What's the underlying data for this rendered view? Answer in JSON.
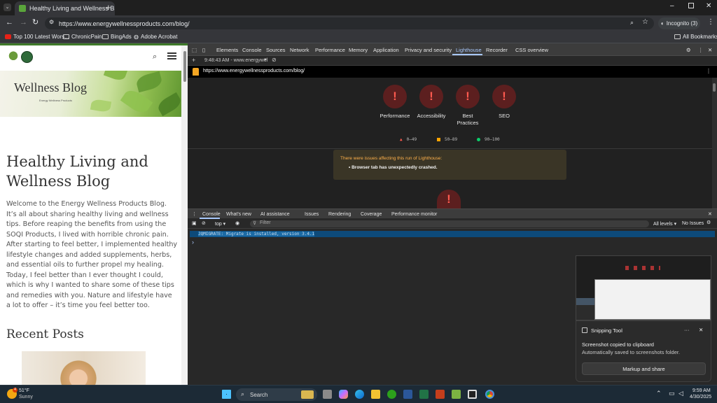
{
  "browser": {
    "tab_title": "Healthy Living and Wellness Blo",
    "url": "https://www.energywellnessproducts.com/blog/",
    "incognito_label": "Incognito (3)",
    "bookmarks": [
      "Top 100 Latest Wors...",
      "ChronicPain",
      "BingAds",
      "Adobe Acrobat"
    ],
    "all_bookmarks": "All Bookmarks"
  },
  "site": {
    "banner_title": "Wellness Blog",
    "banner_subtitle": "Energy Wellness Products",
    "heading": "Healthy Living and Wellness Blog",
    "intro": "Welcome to the Energy Wellness Products Blog. It’s all about sharing healthy living and wellness tips. Before reaping the benefits from using the SOQI Products, I lived with horrible chronic pain. After starting to feel better, I implemented healthy lifestyle changes and added supplements, herbs, and essential oils to further propel my healing. Today, I feel better than I ever thought I could, which is why I wanted to share some of these tips and remedies with you.  Nature and lifestyle have a lot to offer – it’s time you feel better too.",
    "recent_posts": "Recent Posts"
  },
  "devtools": {
    "tabs": [
      "Elements",
      "Console",
      "Sources",
      "Network",
      "Performance",
      "Memory",
      "Application",
      "Privacy and security",
      "Lighthouse",
      "Recorder",
      "CSS overview"
    ],
    "active_tab": "Lighthouse",
    "report_time": "9:48:43 AM - www.energywel",
    "report_url": "https://www.energywellnessproducts.com/blog/",
    "categories": [
      "Performance",
      "Accessibility",
      "Best Practices",
      "SEO"
    ],
    "gauge_symbol": "!",
    "legend": [
      "0–49",
      "50–89",
      "90–100"
    ],
    "warning_title": "There were issues affecting this run of Lighthouse:",
    "warning_item": "Browser tab has unexpectedly crashed.",
    "console_tabs": [
      "Console",
      "What's new",
      "AI assistance",
      "Issues",
      "Rendering",
      "Coverage",
      "Performance monitor"
    ],
    "context": "top",
    "filter_placeholder": "Filter",
    "levels": "All levels",
    "no_issues": "No Issues",
    "console_message": "JQMIGRATE: Migrate is installed, version 3.4.1",
    "prompt": "›"
  },
  "notification": {
    "app": "Snipping Tool",
    "title": "Screenshot copied to clipboard",
    "body": "Automatically saved to screenshots folder.",
    "button": "Markup and share"
  },
  "taskbar": {
    "temp": "51°F",
    "weather": "Sunny",
    "search_placeholder": "Search",
    "time": "9:59 AM",
    "date": "4/30/2025",
    "weather_badge": "4"
  },
  "colors": {
    "lighthouse_fail": "#ff5a4f",
    "lighthouse_avg": "#ffa400",
    "lighthouse_pass": "#0cce6b",
    "console_highlight": "#0d4a7a",
    "site_green": "#3f7a2a"
  }
}
